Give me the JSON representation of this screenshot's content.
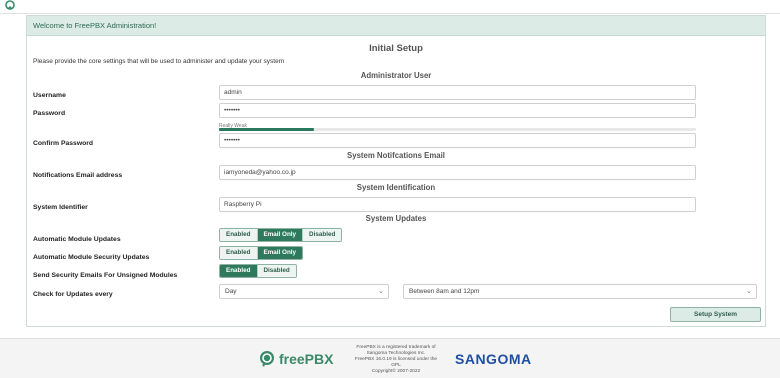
{
  "panel": {
    "header": "Welcome to FreePBX Administration!"
  },
  "setup": {
    "title": "Initial Setup",
    "intro": "Please provide the core settings that will be used to administer and update your system",
    "sections": {
      "admin": "Administrator User",
      "email": "System Notifcations Email",
      "ident": "System Identification",
      "updates": "System Updates"
    }
  },
  "fields": {
    "username": {
      "label": "Username",
      "value": "admin"
    },
    "password": {
      "label": "Password",
      "value": "•••••••"
    },
    "strength": {
      "text": "Really Weak",
      "fraction": 0.2
    },
    "confirm": {
      "label": "Confirm Password",
      "value": "•••••••"
    },
    "email": {
      "label": "Notifications Email address",
      "value": "iamyoneda@yahoo.co.jp"
    },
    "identifier": {
      "label": "System Identifier",
      "value": "Raspberry Pi"
    }
  },
  "updates": {
    "auto_module": {
      "label": "Automatic Module Updates",
      "options": [
        "Enabled",
        "Email Only",
        "Disabled"
      ],
      "selected": "Email Only"
    },
    "auto_security": {
      "label": "Automatic Module Security Updates",
      "options": [
        "Enabled",
        "Email Only"
      ],
      "selected": "Email Only"
    },
    "unsigned": {
      "label": "Send Security Emails For Unsigned Modules",
      "options": [
        "Enabled",
        "Disabled"
      ],
      "selected": "Enabled"
    },
    "check": {
      "label": "Check for Updates every",
      "frequency": "Day",
      "window": "Between 8am and 12pm"
    }
  },
  "actions": {
    "setup": "Setup System"
  },
  "footer": {
    "logo_text": "freePBX",
    "legal_lines": [
      "FreePBX is a registered trademark of",
      "Sangoma Technologies Inc.",
      "FreePBX 16.0.19 is licensed under the",
      "GPL",
      "Copyright© 2007-2022"
    ],
    "sangoma": "SANGOMA"
  },
  "colors": {
    "brand_green": "#2f7a5c",
    "sangoma_blue": "#1e4fa3"
  }
}
